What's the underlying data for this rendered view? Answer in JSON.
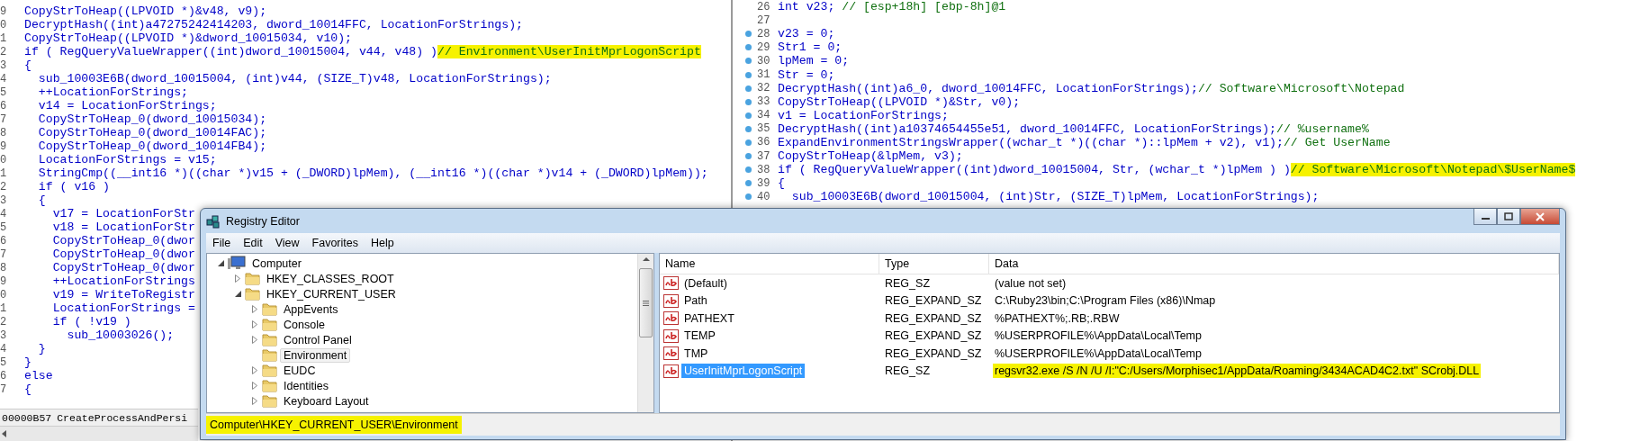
{
  "left_code": {
    "lines": [
      {
        "number": "9",
        "code": "CopyStrToHeap((LPVOID *)&v48, v9);"
      },
      {
        "number": "0",
        "code": "DecryptHash((int)a47275242414203, dword_10014FFC, LocationForStrings);"
      },
      {
        "number": "1",
        "code": "CopyStrToHeap((LPVOID *)&dword_10015034, v10);"
      },
      {
        "number": "2",
        "code": "if ( RegQueryValueWrapper((int)dword_10015004, v44, v48) )",
        "comment": "// Environment\\UserInitMprLogonScript",
        "highlighted": true
      },
      {
        "number": "3",
        "code": "{"
      },
      {
        "number": "4",
        "code": "  sub_10003E6B(dword_10015004, (int)v44, (SIZE_T)v48, LocationForStrings);"
      },
      {
        "number": "5",
        "code": "  ++LocationForStrings;"
      },
      {
        "number": "6",
        "code": "  v14 = LocationForStrings;"
      },
      {
        "number": "7",
        "code": "  CopyStrToHeap_0(dword_10015034);"
      },
      {
        "number": "8",
        "code": "  CopyStrToHeap_0(dword_10014FAC);"
      },
      {
        "number": "9",
        "code": "  CopyStrToHeap_0(dword_10014FB4);"
      },
      {
        "number": "0",
        "code": "  LocationForStrings = v15;"
      },
      {
        "number": "1",
        "code": "  StringCmp((__int16 *)((char *)v15 + (_DWORD)lpMem), (__int16 *)((char *)v14 + (_DWORD)lpMem));"
      },
      {
        "number": "2",
        "code": "  if ( v16 )"
      },
      {
        "number": "3",
        "code": "  {"
      },
      {
        "number": "4",
        "code": "    v17 = LocationForStr"
      },
      {
        "number": "5",
        "code": "    v18 = LocationForStr"
      },
      {
        "number": "6",
        "code": "    CopyStrToHeap_0(dwor"
      },
      {
        "number": "7",
        "code": "    CopyStrToHeap_0(dwor"
      },
      {
        "number": "8",
        "code": "    CopyStrToHeap_0(dwor"
      },
      {
        "number": "9",
        "code": "    ++LocationForStrings"
      },
      {
        "number": "0",
        "code": "    v19 = WriteToRegistr"
      },
      {
        "number": "1",
        "code": "    LocationForStrings ="
      },
      {
        "number": "2",
        "code": "    if ( !v19 )"
      },
      {
        "number": "3",
        "code": "      sub_10003026();"
      },
      {
        "number": "4",
        "code": "  }"
      },
      {
        "number": "5",
        "code": "}"
      },
      {
        "number": "6",
        "code": "else"
      },
      {
        "number": "7",
        "code": "{"
      }
    ],
    "status": {
      "address": "00000B57",
      "function": "CreateProcessAndPersi"
    }
  },
  "right_code": {
    "lines": [
      {
        "number": "26",
        "dot": false,
        "code": "int v23;",
        "comment": " // [esp+18h] [ebp-8h]@1",
        "highlighted": false
      },
      {
        "number": "27",
        "dot": false
      },
      {
        "number": "28",
        "dot": true,
        "code": "v23 = 0;"
      },
      {
        "number": "29",
        "dot": true,
        "code": "Str1 = 0;"
      },
      {
        "number": "30",
        "dot": true,
        "code": "lpMem = 0;"
      },
      {
        "number": "31",
        "dot": true,
        "code": "Str = 0;"
      },
      {
        "number": "32",
        "dot": true,
        "code": "DecryptHash((int)a6_0, dword_10014FFC, LocationForStrings);",
        "comment": "// Software\\Microsoft\\Notepad",
        "highlighted": false
      },
      {
        "number": "33",
        "dot": true,
        "code": "CopyStrToHeap((LPVOID *)&Str, v0);"
      },
      {
        "number": "34",
        "dot": true,
        "code": "v1 = LocationForStrings;"
      },
      {
        "number": "35",
        "dot": true,
        "code": "DecryptHash((int)a10374654455e51, dword_10014FFC, LocationForStrings);",
        "comment": "// %username%",
        "highlighted": false
      },
      {
        "number": "36",
        "dot": true,
        "code": "ExpandEnvironmentStringsWrapper((wchar_t *)((char *)::lpMem + v2), v1);",
        "comment": "// Get UserName",
        "highlighted": false
      },
      {
        "number": "37",
        "dot": true,
        "code": "CopyStrToHeap(&lpMem, v3);"
      },
      {
        "number": "38",
        "dot": true,
        "code": "if ( RegQueryValueWrapper((int)dword_10015004, Str, (wchar_t *)lpMem ) )",
        "comment": "// Software\\Microsoft\\Notepad\\$UserName$",
        "highlighted": true
      },
      {
        "number": "39",
        "dot": true,
        "code": "{"
      },
      {
        "number": "40",
        "dot": true,
        "code": "  sub_10003E6B(dword_10015004, (int)Str, (SIZE_T)lpMem, LocationForStrings);"
      }
    ]
  },
  "registry_window": {
    "title": "Registry Editor",
    "menu": [
      "File",
      "Edit",
      "View",
      "Favorites",
      "Help"
    ],
    "tree": [
      {
        "label": "Computer",
        "kind": "computer",
        "expanded": true,
        "selected": false,
        "children": [
          {
            "label": "HKEY_CLASSES_ROOT",
            "kind": "folder",
            "expanded": false,
            "selected": false,
            "has_children": true
          },
          {
            "label": "HKEY_CURRENT_USER",
            "kind": "folder",
            "expanded": true,
            "selected": false,
            "has_children": true,
            "children": [
              {
                "label": "AppEvents",
                "kind": "folder",
                "expanded": false,
                "selected": false,
                "has_children": true
              },
              {
                "label": "Console",
                "kind": "folder",
                "expanded": false,
                "selected": false,
                "has_children": true
              },
              {
                "label": "Control Panel",
                "kind": "folder",
                "expanded": false,
                "selected": false,
                "has_children": true
              },
              {
                "label": "Environment",
                "kind": "folder",
                "expanded": false,
                "selected": true,
                "has_children": false
              },
              {
                "label": "EUDC",
                "kind": "folder",
                "expanded": false,
                "selected": false,
                "has_children": true
              },
              {
                "label": "Identities",
                "kind": "folder",
                "expanded": false,
                "selected": false,
                "has_children": true
              },
              {
                "label": "Keyboard Layout",
                "kind": "folder",
                "expanded": false,
                "selected": false,
                "has_children": true
              }
            ]
          }
        ]
      }
    ],
    "columns": [
      "Name",
      "Type",
      "Data"
    ],
    "values": [
      {
        "name": "(Default)",
        "type": "REG_SZ",
        "data": "(value not set)",
        "selected": false,
        "highlighted": false
      },
      {
        "name": "Path",
        "type": "REG_EXPAND_SZ",
        "data": "C:\\Ruby23\\bin;C:\\Program Files (x86)\\Nmap",
        "selected": false,
        "highlighted": false
      },
      {
        "name": "PATHEXT",
        "type": "REG_EXPAND_SZ",
        "data": "%PATHEXT%;.RB;.RBW",
        "selected": false,
        "highlighted": false
      },
      {
        "name": "TEMP",
        "type": "REG_EXPAND_SZ",
        "data": "%USERPROFILE%\\AppData\\Local\\Temp",
        "selected": false,
        "highlighted": false
      },
      {
        "name": "TMP",
        "type": "REG_EXPAND_SZ",
        "data": "%USERPROFILE%\\AppData\\Local\\Temp",
        "selected": false,
        "highlighted": false
      },
      {
        "name": "UserInitMprLogonScript",
        "type": "REG_SZ",
        "data": "regsvr32.exe /S /N /U /I:\"C:/Users/Morphisec1/AppData/Roaming/3434ACAD4C2.txt\" SCrobj.DLL",
        "selected": true,
        "highlighted": true
      }
    ],
    "status": {
      "path": "Computer\\HKEY_CURRENT_USER\\Environment",
      "highlighted": true
    }
  }
}
